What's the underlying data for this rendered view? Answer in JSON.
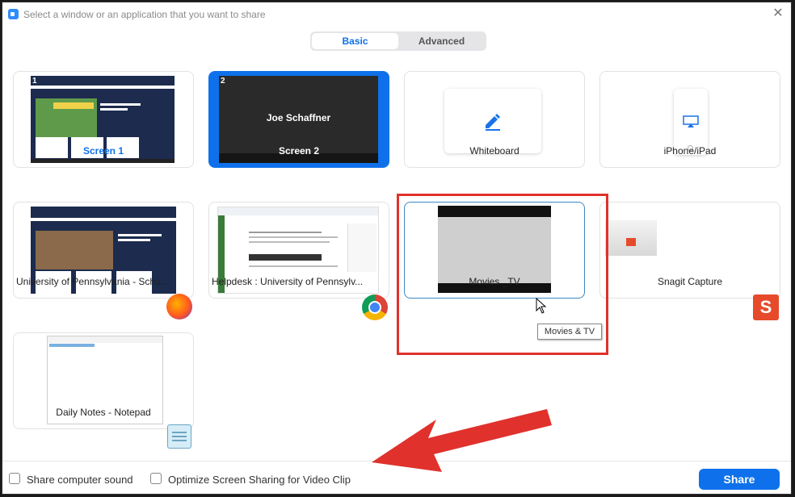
{
  "window": {
    "title": "Select a window or an application that you want to share",
    "close_glyph": "✕"
  },
  "tabs": {
    "basic": "Basic",
    "advanced": "Advanced"
  },
  "cards": [
    {
      "label": "Screen 1",
      "number": "1"
    },
    {
      "label": "Screen 2",
      "number": "2",
      "inner_text": "Joe Schaffner"
    },
    {
      "label": "Whiteboard"
    },
    {
      "label": "iPhone/iPad"
    },
    {
      "label": "University of Pennsylvania - Scho..."
    },
    {
      "label": "Helpdesk : University of Pennsylv..."
    },
    {
      "label": "Movies _TV"
    },
    {
      "label": "Snagit Capture"
    },
    {
      "label": "Daily Notes - Notepad"
    }
  ],
  "tooltip": "Movies & TV",
  "options": {
    "computer_sound": "Share computer sound",
    "optimize_video": "Optimize Screen Sharing for Video Clip"
  },
  "share_button": "Share",
  "colors": {
    "accent": "#0e71eb",
    "annotation": "#e0312c"
  },
  "icons": [
    "video-camera-icon",
    "close-icon",
    "pen-icon",
    "airplay-icon",
    "firefox-icon",
    "chrome-icon",
    "snagit-icon",
    "notepad-icon",
    "mouse-cursor-icon",
    "arrow-annotation"
  ]
}
